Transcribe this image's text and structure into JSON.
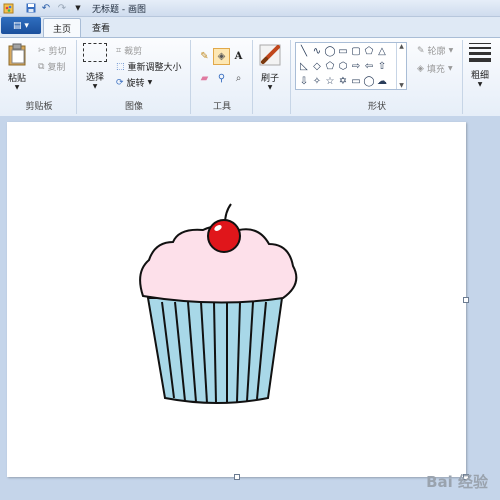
{
  "window": {
    "title": "无标题 - 画图"
  },
  "tabs": {
    "file": "",
    "home": "主页",
    "view": "查看"
  },
  "clipboard": {
    "paste": "粘贴",
    "cut": "剪切",
    "copy": "复制",
    "group": "剪贴板"
  },
  "image": {
    "select": "选择",
    "crop": "裁剪",
    "resize": "重新调整大小",
    "rotate": "旋转",
    "group": "图像"
  },
  "tools": {
    "group": "工具"
  },
  "brushes": {
    "label": "刷子"
  },
  "shapes": {
    "group": "形状",
    "outline": "轮廓",
    "fill": "填充"
  },
  "size": {
    "label": "粗细"
  },
  "icons": [
    "paint-app-icon",
    "save-icon",
    "undo-icon",
    "redo-icon",
    "quick-access-dropdown-icon",
    "pencil-icon",
    "fill-bucket-icon",
    "text-icon",
    "eraser-icon",
    "color-picker-icon",
    "magnifier-icon",
    "brush-icon"
  ],
  "colors": {
    "canvas_bg": "#ffffff",
    "workspace_bg": "#c5d5ea",
    "file_tab": "#1b4f9c",
    "frosting": "#fde0ea",
    "liner": "#a8d8e8",
    "cherry": "#e0161b"
  },
  "watermark": "Bai 经验"
}
